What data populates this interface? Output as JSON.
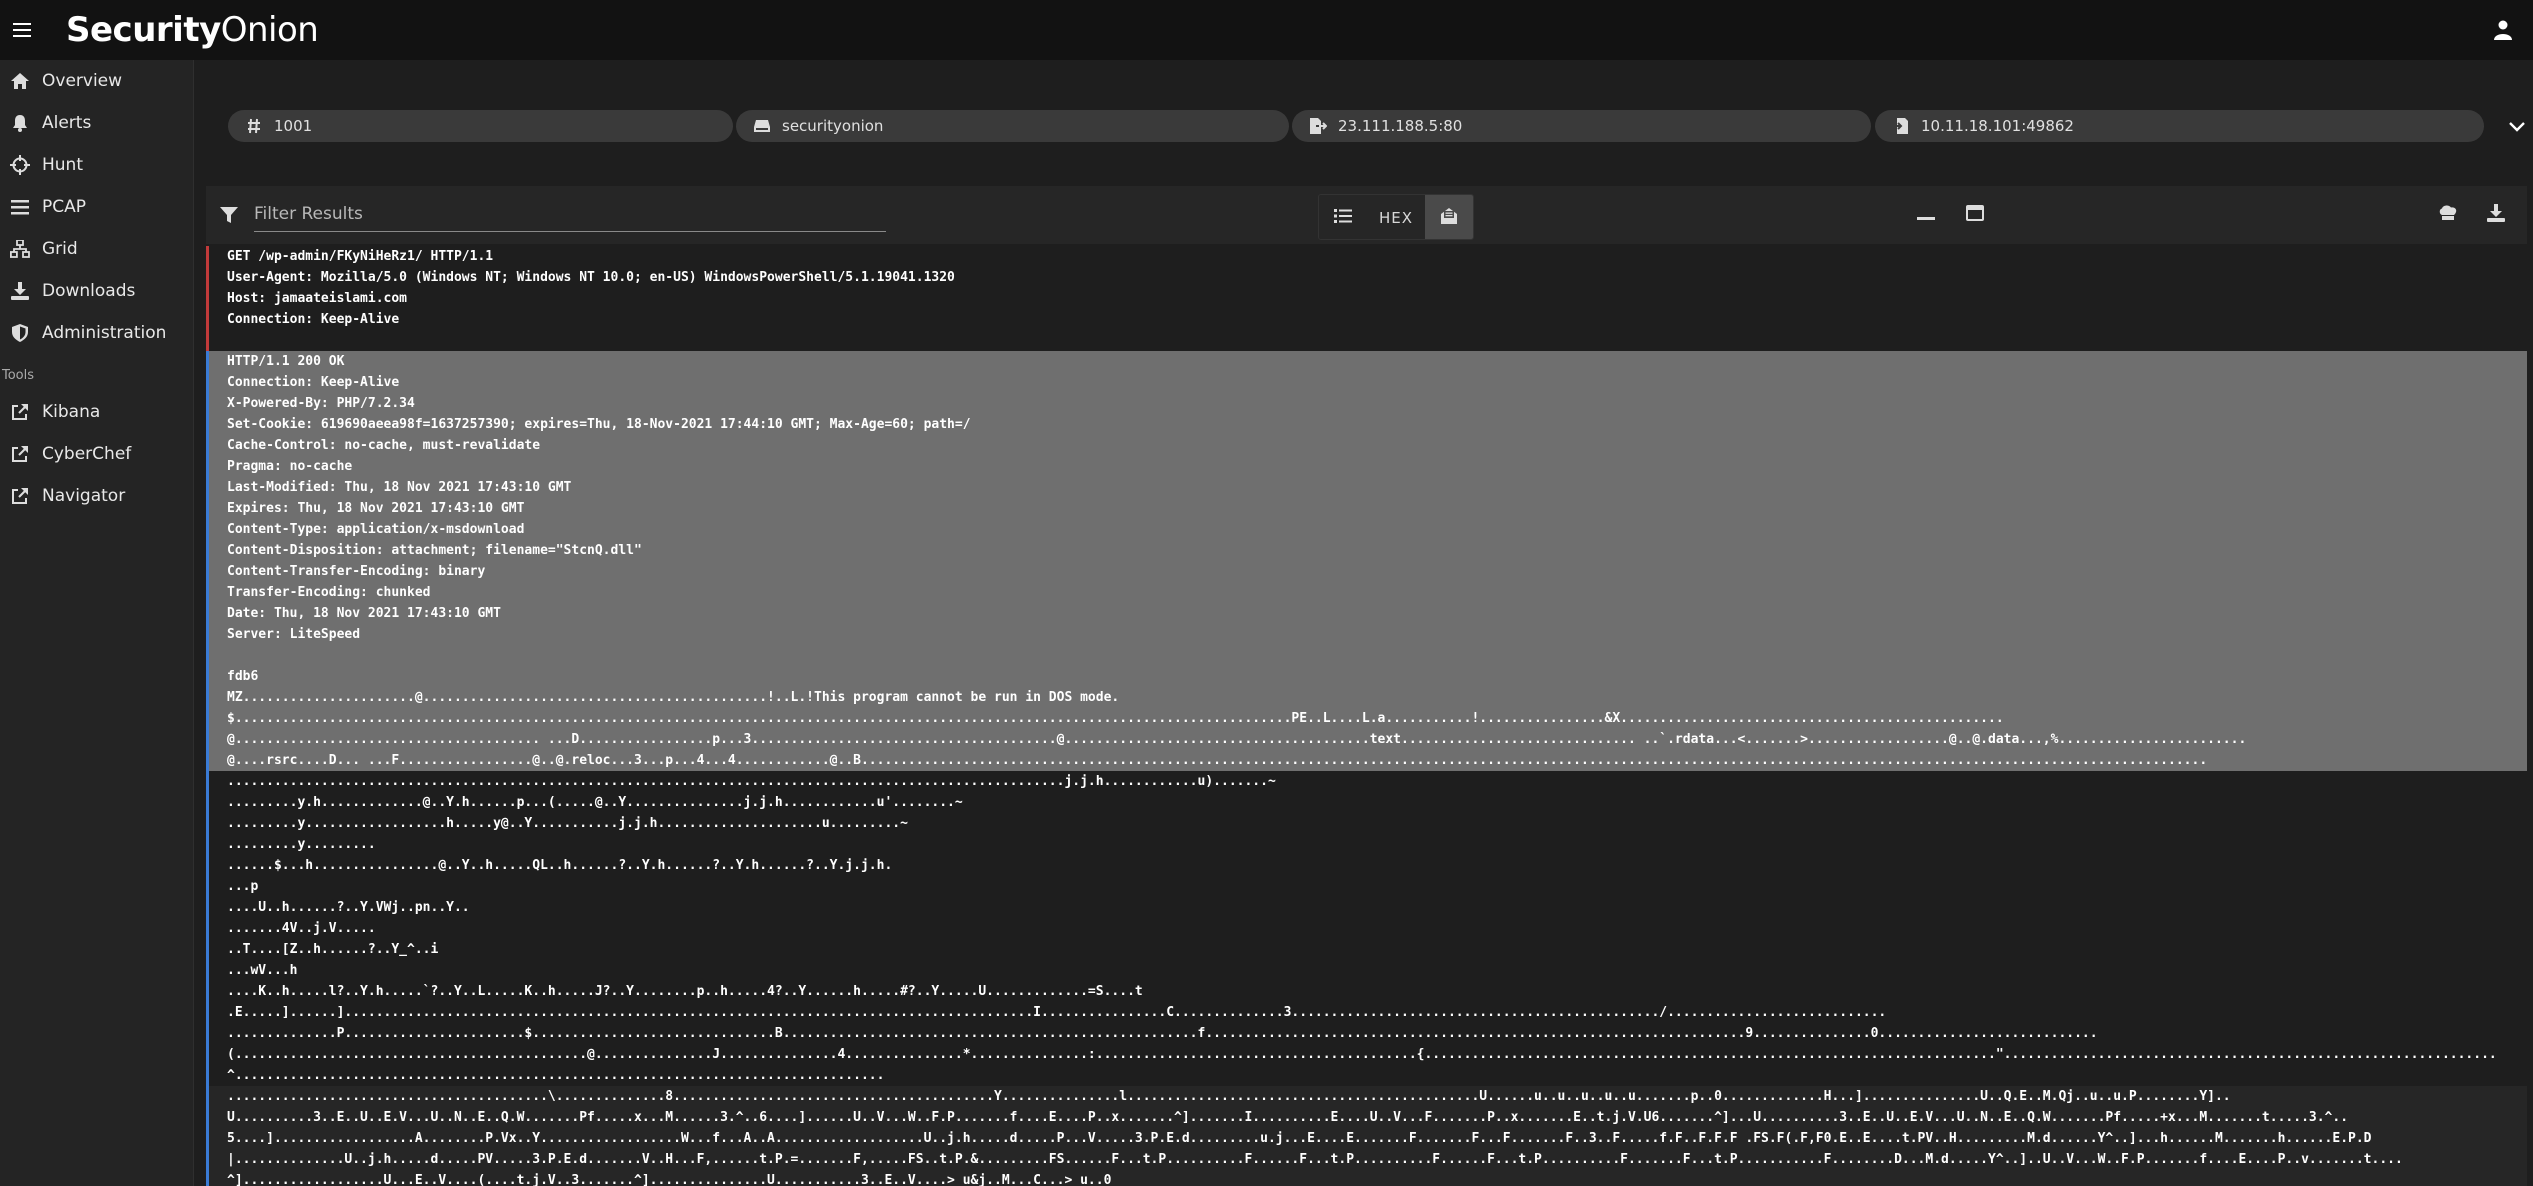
{
  "app": {
    "logo_bold": "Security",
    "logo_light": "Onion"
  },
  "nav": {
    "items": [
      {
        "label": "Overview",
        "icon": "home-icon"
      },
      {
        "label": "Alerts",
        "icon": "bell-icon"
      },
      {
        "label": "Hunt",
        "icon": "crosshairs-icon"
      },
      {
        "label": "PCAP",
        "icon": "list-icon"
      },
      {
        "label": "Grid",
        "icon": "sitemap-icon"
      },
      {
        "label": "Downloads",
        "icon": "download-icon"
      },
      {
        "label": "Administration",
        "icon": "shield-icon"
      }
    ],
    "tools_label": "Tools",
    "tools": [
      {
        "label": "Kibana",
        "icon": "external-link-icon"
      },
      {
        "label": "CyberChef",
        "icon": "external-link-icon"
      },
      {
        "label": "Navigator",
        "icon": "external-link-icon"
      }
    ]
  },
  "chips": {
    "id": "1001",
    "sensor": "securityonion",
    "source": "23.111.188.5:80",
    "destination": "10.11.18.101:49862"
  },
  "toolbar": {
    "filter_placeholder": "Filter Results",
    "hex_label": "HEX"
  },
  "transcript": {
    "client": [
      "GET /wp-admin/FKyNiHeRz1/ HTTP/1.1",
      "User-Agent: Mozilla/5.0 (Windows NT; Windows NT 10.0; en-US) WindowsPowerShell/5.1.19041.1320",
      "Host: jamaateislami.com",
      "Connection: Keep-Alive",
      ""
    ],
    "server_highlight": [
      "HTTP/1.1 200 OK",
      "Connection: Keep-Alive",
      "X-Powered-By: PHP/7.2.34",
      "Set-Cookie: 619690aeea98f=1637257390; expires=Thu, 18-Nov-2021 17:44:10 GMT; Max-Age=60; path=/",
      "Cache-Control: no-cache, must-revalidate",
      "Pragma: no-cache",
      "Last-Modified: Thu, 18 Nov 2021 17:43:10 GMT",
      "Expires: Thu, 18 Nov 2021 17:43:10 GMT",
      "Content-Type: application/x-msdownload",
      "Content-Disposition: attachment; filename=\"StcnQ.dll\"",
      "Content-Transfer-Encoding: binary",
      "Transfer-Encoding: chunked",
      "Date: Thu, 18 Nov 2021 17:43:10 GMT",
      "Server: LiteSpeed",
      "",
      "fdb6",
      "MZ......................@............................................!..L.!This program cannot be run in DOS mode.",
      "$.......................................................................................................................................PE..L....L.a...........!................&X.................................................",
      "@....................................... ...D.................p...3.......................................@.......................................text.............................. ..`.rdata...<.......>..................@..@.data...,%........................",
      "@....rsrc....D... ...F.................@..@.reloc...3...p...4...4............@..B............................................................................................................................................................................"
    ],
    "server": [
      "...........................................................................................................j.j.h............u).......~",
      ".........y.h.............@..Y.h......p...(.....@..Y...............j.j.h............u'........~",
      ".........y..................h.....y@..Y...........j.j.h.....................u.........~",
      ".........y.........",
      "......$...h................@..Y..h.....QL..h......?..Y.h......?..Y.h......?..Y.j.j.h.",
      "...p",
      "....U..h......?..Y.VWj..pn..Y..",
      ".......4V..j.V.....",
      "..T....[Z..h......?..Y_^..i",
      "...wV...h",
      "....K..h.....l?..Y.h.....`?..Y..L.....K..h.....J?..Y........p..h.....4?..Y......h.....#?..Y.....U.............=S....t",
      ".E.....]......]........................................................................................I................C..............3.............................................../............................",
      "..............P.......................$...............................B.....................................................f.....................................................................9...............0............................",
      "(.............................................@...............J...............4...............*...............:.........................................{.........................................................................\"...............................................................",
      "^..................................................................................."
    ],
    "server2": [
      ".........................................\\..............8.........................................Y...............l.............................................U......u..u..u..u..u.......p..0.............H...]...............U..Q.E..M.Qj..u..u.P........Y]..",
      "U..........3..E..U..E.V...U..N..E..Q.W.......Pf.....x...M......3.^..6....]......U..V...W..F.P.......f....E....P..x.......^].......I..........E....U..V...F.......P..x.......E..t.j.V.U6.......^]...U..........3..E..U..E.V...U..N..E..Q.W.......Pf.....+x...M.......t.....3.^..",
      "5....]..................A........P.Vx..Y..................W...f...A..A...................U..j.h.....d.....P...V.....3.P.E.d.........u.j...E....E.......F.......F...F.......F..3..F.....f.F..F.F.F .FS.F(.F,F0.E..E....t.PV..H.........M.d......Y^..]...h......M.......h......E.P.D",
      "|..............U..j.h.....d.....PV.....3.P.E.d.......V..H...F,......t.P.=.......F,.....FS..t.P.&.........FS......F...t.P..........F......F...t.P..........F......F...t.P..........F.......F...t.P...........F........D...M.d.....Y^..]..U..V...W..F.P.......f....E....P..v.......t....",
      "^]..................U...E..V....(....t.j.V..3.......^]...............U...........3..E..V....> u&j..M...C...> u..0"
    ]
  }
}
